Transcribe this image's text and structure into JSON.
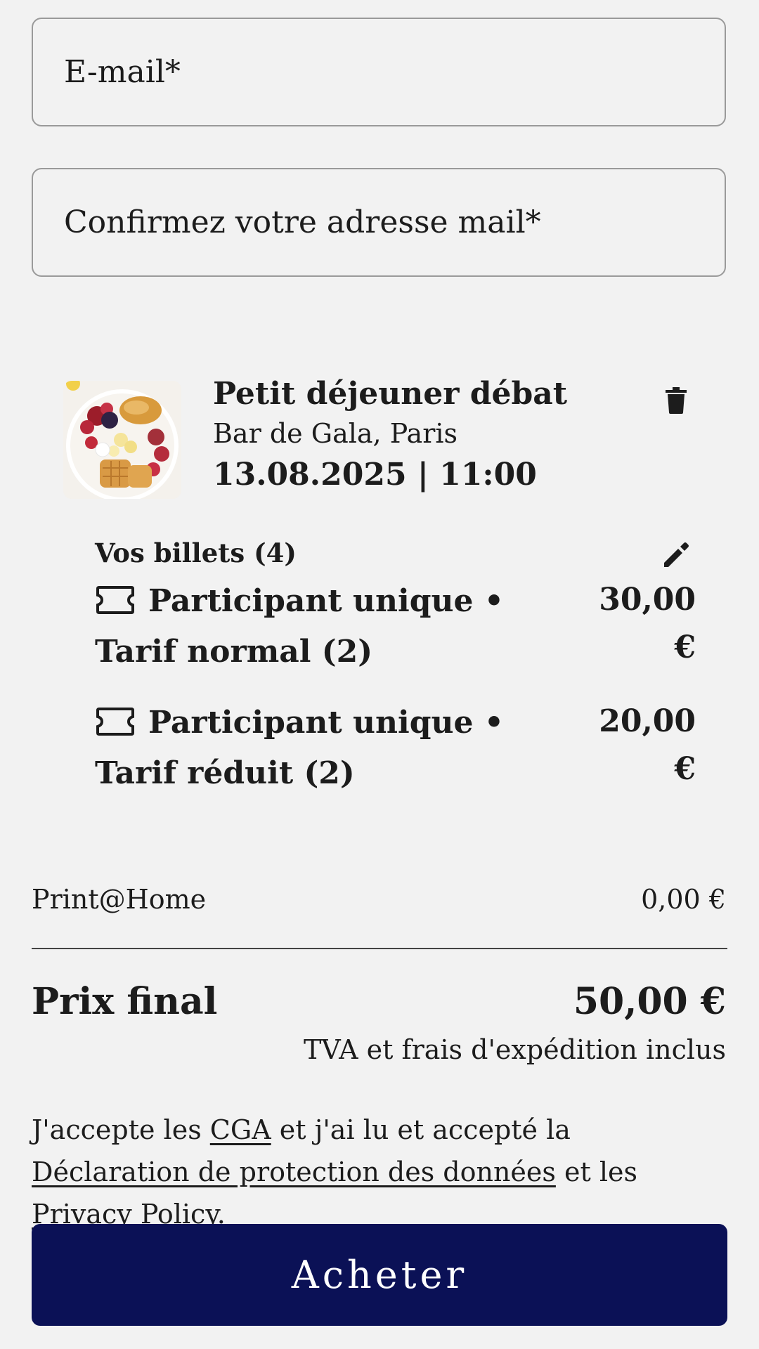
{
  "form": {
    "email_placeholder": "E-mail*",
    "confirm_placeholder": "Confirmez votre adresse mail*"
  },
  "event": {
    "title": "Petit déjeuner débat",
    "venue": "Bar de Gala, Paris",
    "datetime": "13.08.2025 | 11:00",
    "thumbnail_icon": "breakfast-image",
    "delete_icon": "trash-icon"
  },
  "tickets": {
    "heading": "Vos billets (4)",
    "edit_icon": "pencil-icon",
    "ticket_icon": "ticket-icon",
    "items": [
      {
        "label": "Participant unique • Tarif normal (2)",
        "price": "30,00 €"
      },
      {
        "label": "Participant unique • Tarif réduit (2)",
        "price": "20,00 €"
      }
    ]
  },
  "summary": {
    "fee_label": "Print@Home",
    "fee_value": "0,00 €",
    "total_label": "Prix final",
    "total_value": "50,00 €",
    "vat_note": "TVA et frais d'expédition inclus"
  },
  "terms": {
    "text_1": "J'accepte les ",
    "link_cga": "CGA",
    "text_2": " et j'ai lu et accepté la ",
    "link_privacy_decl": "Déclaration de protection des données",
    "text_3": " et les ",
    "link_privacy_policy": "Privacy Policy",
    "text_4": "."
  },
  "actions": {
    "buy_label": "Acheter"
  },
  "colors": {
    "background": "#f2f2f2",
    "primary_button": "#0b1156",
    "text": "#1c1c1c"
  }
}
